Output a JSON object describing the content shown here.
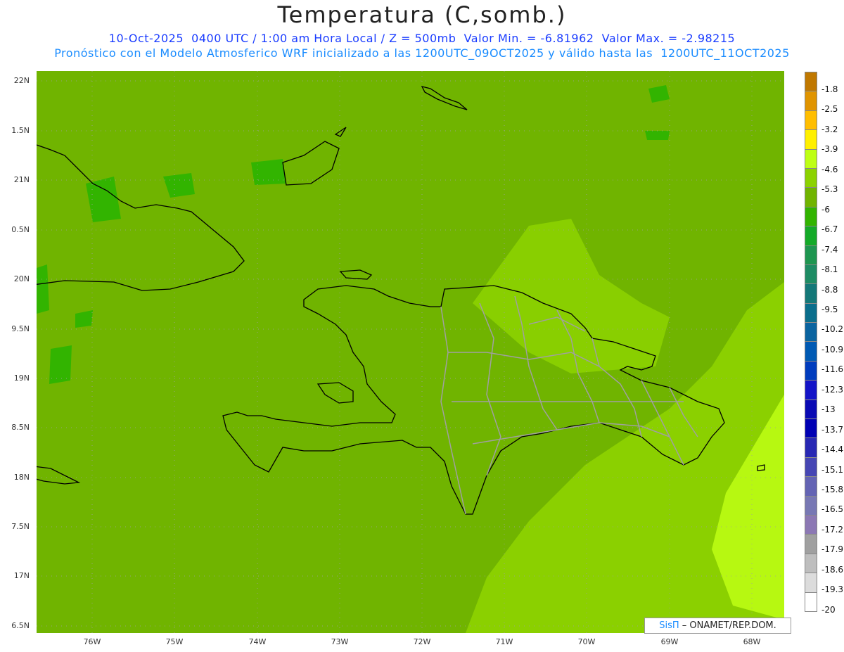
{
  "header": {
    "title": "Temperatura (C,somb.)",
    "line1": "10-Oct-2025  0400 UTC / 1:00 am Hora Local / Z = 500mb  Valor Min. = -6.81962  Valor Max. = -2.98215",
    "line2": "Pronóstico con el Modelo Atmosferico WRF inicializado a las 1200UTC_09OCT2025 y válido hasta las  1200UTC_11OCT2025"
  },
  "axes": {
    "y_ticks": [
      "22N",
      "1.5N",
      "21N",
      "0.5N",
      "20N",
      "9.5N",
      "19N",
      "8.5N",
      "18N",
      "7.5N",
      "17N",
      "6.5N"
    ],
    "x_ticks": [
      "76W",
      "75W",
      "74W",
      "73W",
      "72W",
      "71W",
      "70W",
      "69W",
      "68W"
    ]
  },
  "colorbar": {
    "labels": [
      "-1.8",
      "-2.5",
      "-3.2",
      "-3.9",
      "-4.6",
      "-5.3",
      "-6",
      "-6.7",
      "-7.4",
      "-8.1",
      "-8.8",
      "-9.5",
      "-10.2",
      "-10.9",
      "-11.6",
      "-12.3",
      "-13",
      "-13.7",
      "-14.4",
      "-15.1",
      "-15.8",
      "-16.5",
      "-17.2",
      "-17.9",
      "-18.6",
      "-19.3",
      "-20"
    ],
    "colors": [
      "#c07800",
      "#e09400",
      "#ffbe00",
      "#fff000",
      "#beff14",
      "#8cd200",
      "#70b400",
      "#32b400",
      "#14aa28",
      "#1e9650",
      "#1e8c64",
      "#147878",
      "#0a6e8c",
      "#0a64a0",
      "#005ab4",
      "#003cbe",
      "#1414c8",
      "#0a0ab4",
      "#0000b4",
      "#2828b4",
      "#4646b4",
      "#6464b4",
      "#7878b4",
      "#8c78b4",
      "#a0a0a0",
      "#bebebe",
      "#dcdcdc",
      "#ffffff"
    ]
  },
  "credit": {
    "brand": "SisΠ",
    "text": "– ONAMET/REP.DOM."
  }
}
